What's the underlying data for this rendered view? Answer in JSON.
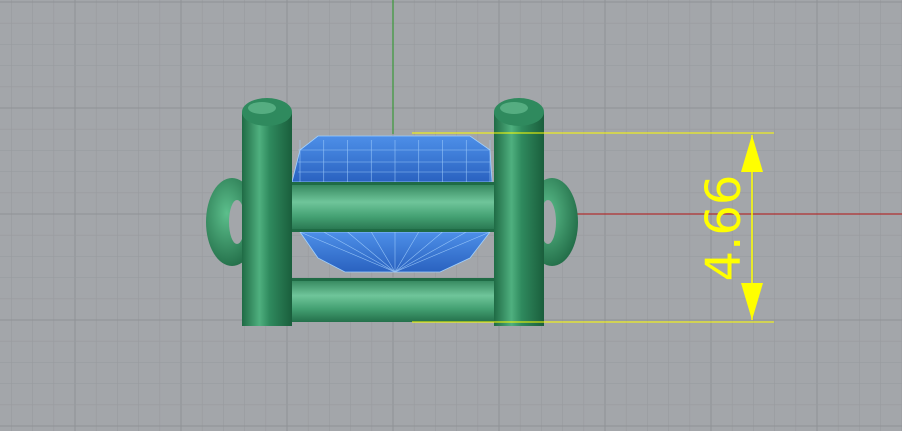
{
  "viewport": {
    "background_color": "#a3a6aa",
    "grid_color": "#989b9f",
    "grid_major_color": "#8f9296",
    "x_axis_color": "#b03030",
    "y_axis_color": "#3a9a3a"
  },
  "model": {
    "metal_color": "#2e8a5e",
    "metal_highlight": "#5fbf8e",
    "gem_color": "#3a7fe0",
    "gem_wire_color": "#9fd0ff"
  },
  "dimension": {
    "value_text": "4.66",
    "color": "#ffff00"
  }
}
